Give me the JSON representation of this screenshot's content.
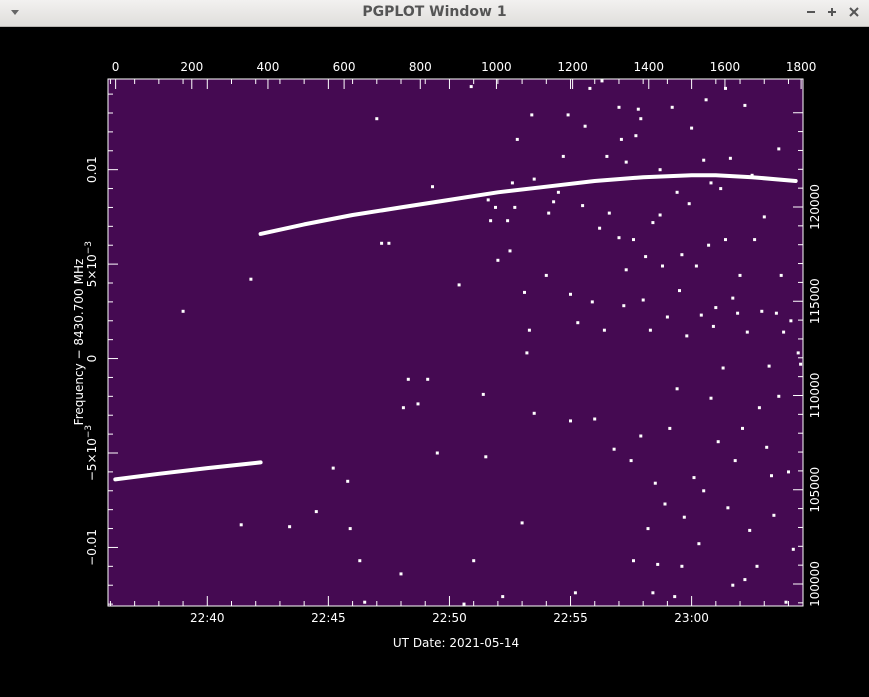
{
  "window": {
    "title": "PGPLOT Window 1",
    "menu_icon": "triangle-down-icon",
    "minimize_label": "—",
    "maximize_label": "+",
    "close_label": "×"
  },
  "plot": {
    "background_color": "#450a52",
    "point_color": "#ffffff",
    "xlabel": "UT Date: 2021-05-14",
    "ylabel_prefix": "Frequency − 8430.700",
    "ylabel_unit": "MHz",
    "x_bottom_ticks": [
      "22:40",
      "22:45",
      "22:50",
      "22:55",
      "23:00"
    ],
    "x_top_ticks": [
      "0",
      "200",
      "400",
      "600",
      "800",
      "1000",
      "1200",
      "1400",
      "1600",
      "1800"
    ],
    "y_left_ticks": [
      "−0.01",
      "−5×10",
      "0",
      "5×10",
      "0.01"
    ],
    "y_left_exp": "−3",
    "y_right_ticks": [
      "100000",
      "105000",
      "110000",
      "115000",
      "120000"
    ]
  },
  "chart_data": {
    "type": "scatter",
    "xlabel": "UT Date: 2021-05-14",
    "ylabel": "Frequency − 8430.700 MHz",
    "x_bottom_axis": {
      "ticks": [
        "22:40",
        "22:45",
        "22:50",
        "22:55",
        "23:00"
      ],
      "range_minutes": [
        -4.1,
        24.6
      ]
    },
    "x_top_axis": {
      "ticks": [
        0,
        200,
        400,
        600,
        800,
        1000,
        1200,
        1400,
        1600,
        1800
      ],
      "range": [
        -20,
        1805
      ]
    },
    "y_left_axis": {
      "range": [
        -0.0131,
        0.0148
      ]
    },
    "y_right_axis": {
      "ticks": [
        100000,
        105000,
        110000,
        115000,
        120000
      ]
    },
    "series": [
      {
        "kind": "curve",
        "points": [
          [
            -3.8,
            -0.0064
          ],
          [
            -2.0,
            -0.0061
          ],
          [
            0.0,
            -0.0058
          ],
          [
            1.5,
            -0.0056
          ],
          [
            2.2,
            -0.0055
          ]
        ]
      },
      {
        "kind": "curve",
        "points": [
          [
            2.2,
            0.0066
          ],
          [
            4.0,
            0.0071
          ],
          [
            6.0,
            0.0076
          ],
          [
            8.0,
            0.008
          ],
          [
            10.0,
            0.0084
          ],
          [
            12.0,
            0.0088
          ],
          [
            14.0,
            0.0091
          ],
          [
            16.0,
            0.0094
          ],
          [
            18.0,
            0.0096
          ],
          [
            20.0,
            0.0097
          ],
          [
            21.0,
            0.0097
          ],
          [
            22.5,
            0.0096
          ],
          [
            24.3,
            0.0094
          ]
        ]
      },
      {
        "kind": "scatter",
        "points": [
          [
            -1.0,
            0.0025
          ],
          [
            1.8,
            0.0042
          ],
          [
            4.5,
            -0.0081
          ],
          [
            5.2,
            -0.0058
          ],
          [
            5.8,
            -0.0065
          ],
          [
            5.9,
            -0.009
          ],
          [
            6.3,
            -0.0107
          ],
          [
            6.5,
            -0.0129
          ],
          [
            7.0,
            0.0127
          ],
          [
            7.2,
            0.0061
          ],
          [
            7.5,
            0.0061
          ],
          [
            8.0,
            -0.0114
          ],
          [
            8.1,
            -0.0026
          ],
          [
            8.3,
            -0.0011
          ],
          [
            8.7,
            -0.0024
          ],
          [
            9.1,
            -0.0011
          ],
          [
            9.3,
            0.0091
          ],
          [
            9.5,
            -0.005
          ],
          [
            10.4,
            0.0039
          ],
          [
            10.9,
            0.0144
          ],
          [
            11.0,
            -0.0107
          ],
          [
            11.4,
            -0.0019
          ],
          [
            11.5,
            -0.0052
          ],
          [
            11.6,
            0.0084
          ],
          [
            11.7,
            0.0073
          ],
          [
            11.9,
            0.008
          ],
          [
            12.0,
            0.0052
          ],
          [
            12.2,
            -0.0126
          ],
          [
            12.5,
            0.0057
          ],
          [
            12.6,
            0.0093
          ],
          [
            12.7,
            0.008
          ],
          [
            12.8,
            0.0116
          ],
          [
            13.0,
            -0.0087
          ],
          [
            13.1,
            0.0035
          ],
          [
            13.2,
            0.0003
          ],
          [
            13.3,
            0.0015
          ],
          [
            13.4,
            0.0129
          ],
          [
            13.5,
            0.0095
          ],
          [
            13.5,
            -0.0029
          ],
          [
            14.0,
            0.0044
          ],
          [
            14.1,
            0.0077
          ],
          [
            14.3,
            0.0083
          ],
          [
            14.5,
            0.0088
          ],
          [
            14.7,
            0.0107
          ],
          [
            15.0,
            0.0034
          ],
          [
            15.0,
            -0.0033
          ],
          [
            15.2,
            -0.0124
          ],
          [
            15.3,
            0.0019
          ],
          [
            15.5,
            0.0081
          ],
          [
            15.8,
            0.0143
          ],
          [
            15.9,
            0.003
          ],
          [
            16.0,
            -0.0032
          ],
          [
            16.2,
            0.0069
          ],
          [
            16.4,
            0.0015
          ],
          [
            16.5,
            0.0107
          ],
          [
            16.6,
            0.0077
          ],
          [
            16.8,
            -0.0048
          ],
          [
            17.0,
            0.0064
          ],
          [
            17.0,
            0.0133
          ],
          [
            17.1,
            0.0116
          ],
          [
            17.2,
            0.0028
          ],
          [
            17.3,
            0.0047
          ],
          [
            17.3,
            0.0104
          ],
          [
            17.5,
            -0.0054
          ],
          [
            17.6,
            0.0063
          ],
          [
            17.7,
            0.0118
          ],
          [
            17.8,
            0.0132
          ],
          [
            17.9,
            -0.0041
          ],
          [
            18.0,
            0.0031
          ],
          [
            18.1,
            0.0054
          ],
          [
            18.2,
            -0.009
          ],
          [
            18.3,
            0.0015
          ],
          [
            18.4,
            0.0072
          ],
          [
            18.5,
            -0.0066
          ],
          [
            18.6,
            -0.0109
          ],
          [
            18.7,
            0.01
          ],
          [
            18.8,
            0.0049
          ],
          [
            18.9,
            -0.0077
          ],
          [
            19.0,
            0.0022
          ],
          [
            19.1,
            -0.0037
          ],
          [
            19.2,
            0.0133
          ],
          [
            19.3,
            -0.0126
          ],
          [
            19.4,
            0.0088
          ],
          [
            19.5,
            0.0036
          ],
          [
            19.6,
            -0.011
          ],
          [
            19.6,
            0.0055
          ],
          [
            19.7,
            -0.0084
          ],
          [
            19.8,
            0.0012
          ],
          [
            19.9,
            0.0082
          ],
          [
            20.0,
            0.0122
          ],
          [
            20.1,
            -0.0063
          ],
          [
            20.2,
            0.0049
          ],
          [
            20.3,
            -0.0098
          ],
          [
            20.4,
            0.0023
          ],
          [
            20.5,
            0.0105
          ],
          [
            20.5,
            -0.007
          ],
          [
            20.6,
            0.0137
          ],
          [
            20.7,
            0.006
          ],
          [
            20.8,
            -0.0021
          ],
          [
            20.9,
            0.0017
          ],
          [
            21.0,
            0.0027
          ],
          [
            21.1,
            -0.0044
          ],
          [
            21.2,
            0.009
          ],
          [
            21.3,
            -0.0005
          ],
          [
            21.4,
            0.0063
          ],
          [
            21.5,
            -0.0079
          ],
          [
            21.6,
            0.0106
          ],
          [
            21.7,
            0.0032
          ],
          [
            21.7,
            -0.012
          ],
          [
            21.8,
            -0.0054
          ],
          [
            21.9,
            0.0024
          ],
          [
            22.0,
            0.0044
          ],
          [
            22.1,
            -0.0037
          ],
          [
            22.2,
            0.0134
          ],
          [
            22.3,
            0.0014
          ],
          [
            22.4,
            -0.0091
          ],
          [
            22.5,
            0.0097
          ],
          [
            22.6,
            0.0063
          ],
          [
            22.7,
            -0.011
          ],
          [
            22.8,
            -0.0026
          ],
          [
            22.9,
            0.0025
          ],
          [
            23.0,
            0.0075
          ],
          [
            23.1,
            -0.0047
          ],
          [
            23.2,
            -0.0004
          ],
          [
            23.3,
            -0.0062
          ],
          [
            23.4,
            -0.0083
          ],
          [
            23.5,
            0.0024
          ],
          [
            23.6,
            -0.002
          ],
          [
            23.7,
            0.0044
          ],
          [
            23.8,
            0.0014
          ],
          [
            23.9,
            -0.0129
          ],
          [
            24.0,
            -0.006
          ],
          [
            24.1,
            0.002
          ],
          [
            24.2,
            -0.0101
          ],
          [
            24.4,
            0.0003
          ],
          [
            24.5,
            -0.0003
          ],
          [
            1.4,
            -0.0088
          ],
          [
            3.4,
            -0.0089
          ],
          [
            10.6,
            -0.013
          ],
          [
            12.4,
            0.0073
          ],
          [
            14.9,
            0.0129
          ],
          [
            16.3,
            0.0147
          ],
          [
            19.4,
            -0.0016
          ],
          [
            21.4,
            0.0143
          ],
          [
            22.2,
            -0.0117
          ],
          [
            23.6,
            0.0111
          ],
          [
            20.8,
            0.0093
          ],
          [
            17.9,
            0.0127
          ],
          [
            18.7,
            0.0076
          ],
          [
            15.6,
            0.0123
          ],
          [
            17.6,
            -0.0107
          ],
          [
            18.4,
            -0.0124
          ]
        ]
      }
    ]
  }
}
